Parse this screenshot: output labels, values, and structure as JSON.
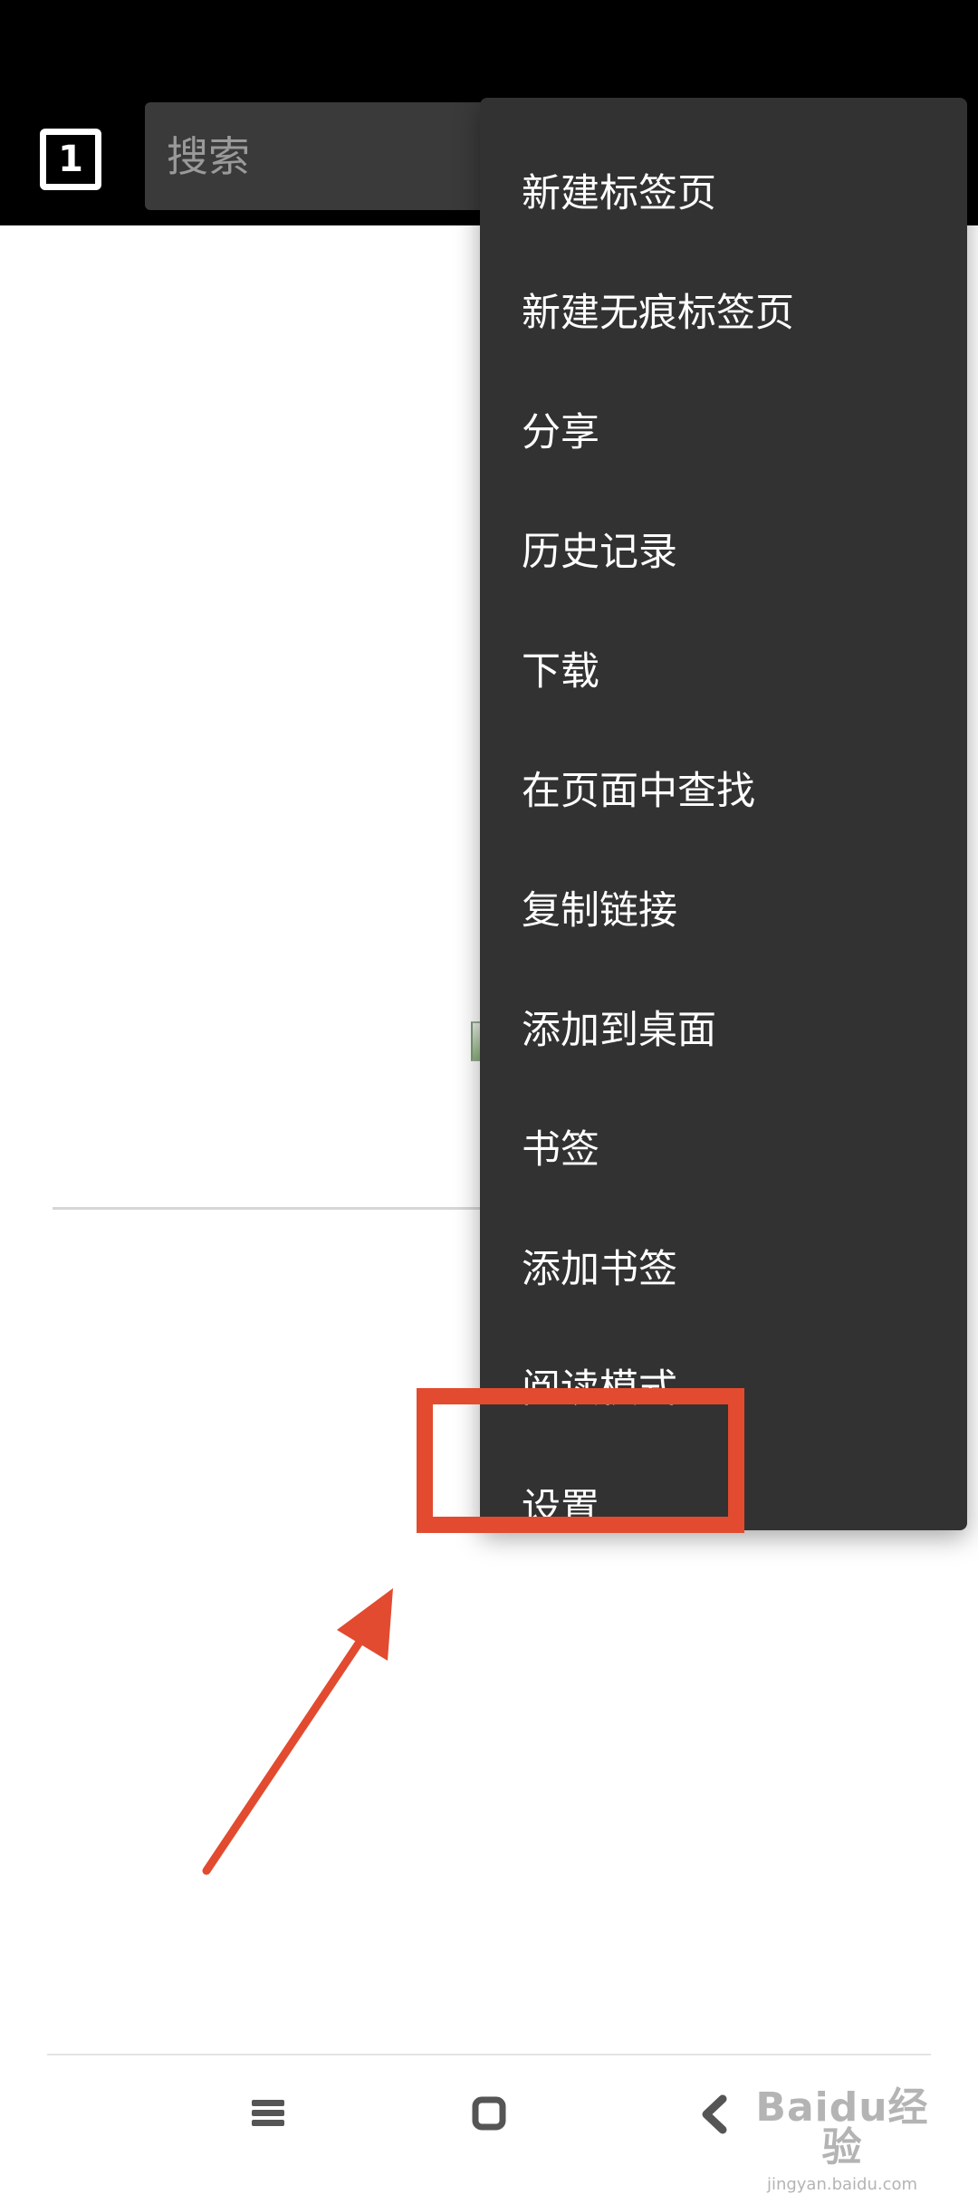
{
  "toolbar": {
    "tab_count": "1",
    "search_placeholder": "搜索"
  },
  "menu": {
    "items": [
      {
        "label": "新建标签页",
        "name": "menu-item-new-tab"
      },
      {
        "label": "新建无痕标签页",
        "name": "menu-item-new-incognito-tab"
      },
      {
        "label": "分享",
        "name": "menu-item-share"
      },
      {
        "label": "历史记录",
        "name": "menu-item-history"
      },
      {
        "label": "下载",
        "name": "menu-item-downloads"
      },
      {
        "label": "在页面中查找",
        "name": "menu-item-find-in-page"
      },
      {
        "label": "复制链接",
        "name": "menu-item-copy-link"
      },
      {
        "label": "添加到桌面",
        "name": "menu-item-add-to-desktop"
      },
      {
        "label": "书签",
        "name": "menu-item-bookmarks"
      },
      {
        "label": "添加书签",
        "name": "menu-item-add-bookmark"
      },
      {
        "label": "阅读模式",
        "name": "menu-item-reader-mode"
      },
      {
        "label": "设置",
        "name": "menu-item-settings"
      }
    ]
  },
  "annotation": {
    "highlight_color": "#e24b2f",
    "highlighted_item": "设置"
  },
  "navigation": {
    "buttons": [
      "menu-icon",
      "home-icon",
      "back-icon"
    ]
  },
  "watermark": {
    "logo_text": "Baidu经验",
    "sub_text": "jingyan.baidu.com"
  },
  "colors": {
    "toolbar_bg": "#000000",
    "menu_bg": "#323232",
    "search_bg": "#3a3a3a",
    "menu_text": "#ffffff"
  }
}
